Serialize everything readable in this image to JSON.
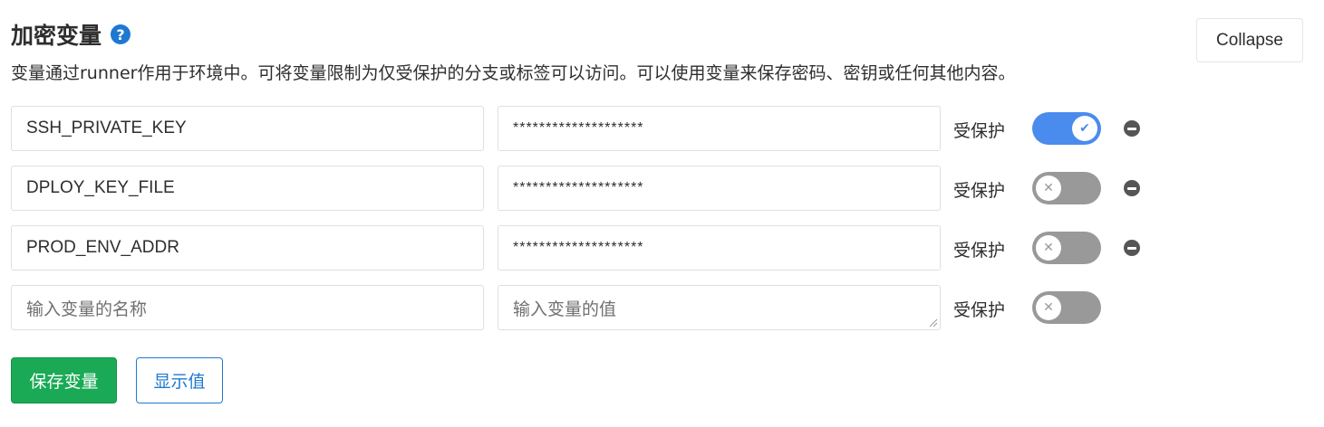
{
  "section": {
    "title": "加密变量",
    "help_icon": "question-circle-icon",
    "collapse_label": "Collapse",
    "description": "变量通过runner作用于环境中。可将变量限制为仅受保护的分支或标签可以访问。可以使用变量来保存密码、密钥或任何其他内容。"
  },
  "variables": [
    {
      "key": "SSH_PRIVATE_KEY",
      "value": "********************",
      "protected_label": "受保护",
      "protected": true
    },
    {
      "key": "DPLOY_KEY_FILE",
      "value": "********************",
      "protected_label": "受保护",
      "protected": false
    },
    {
      "key": "PROD_ENV_ADDR",
      "value": "********************",
      "protected_label": "受保护",
      "protected": false
    }
  ],
  "new_variable": {
    "key_placeholder": "输入变量的名称",
    "value_placeholder": "输入变量的值",
    "protected_label": "受保护",
    "protected": false
  },
  "actions": {
    "save_label": "保存变量",
    "reveal_label": "显示值"
  },
  "colors": {
    "toggle_on": "#4a8bee",
    "toggle_off": "#999999",
    "save_button": "#1aaa55",
    "link_blue": "#1f78d1"
  }
}
